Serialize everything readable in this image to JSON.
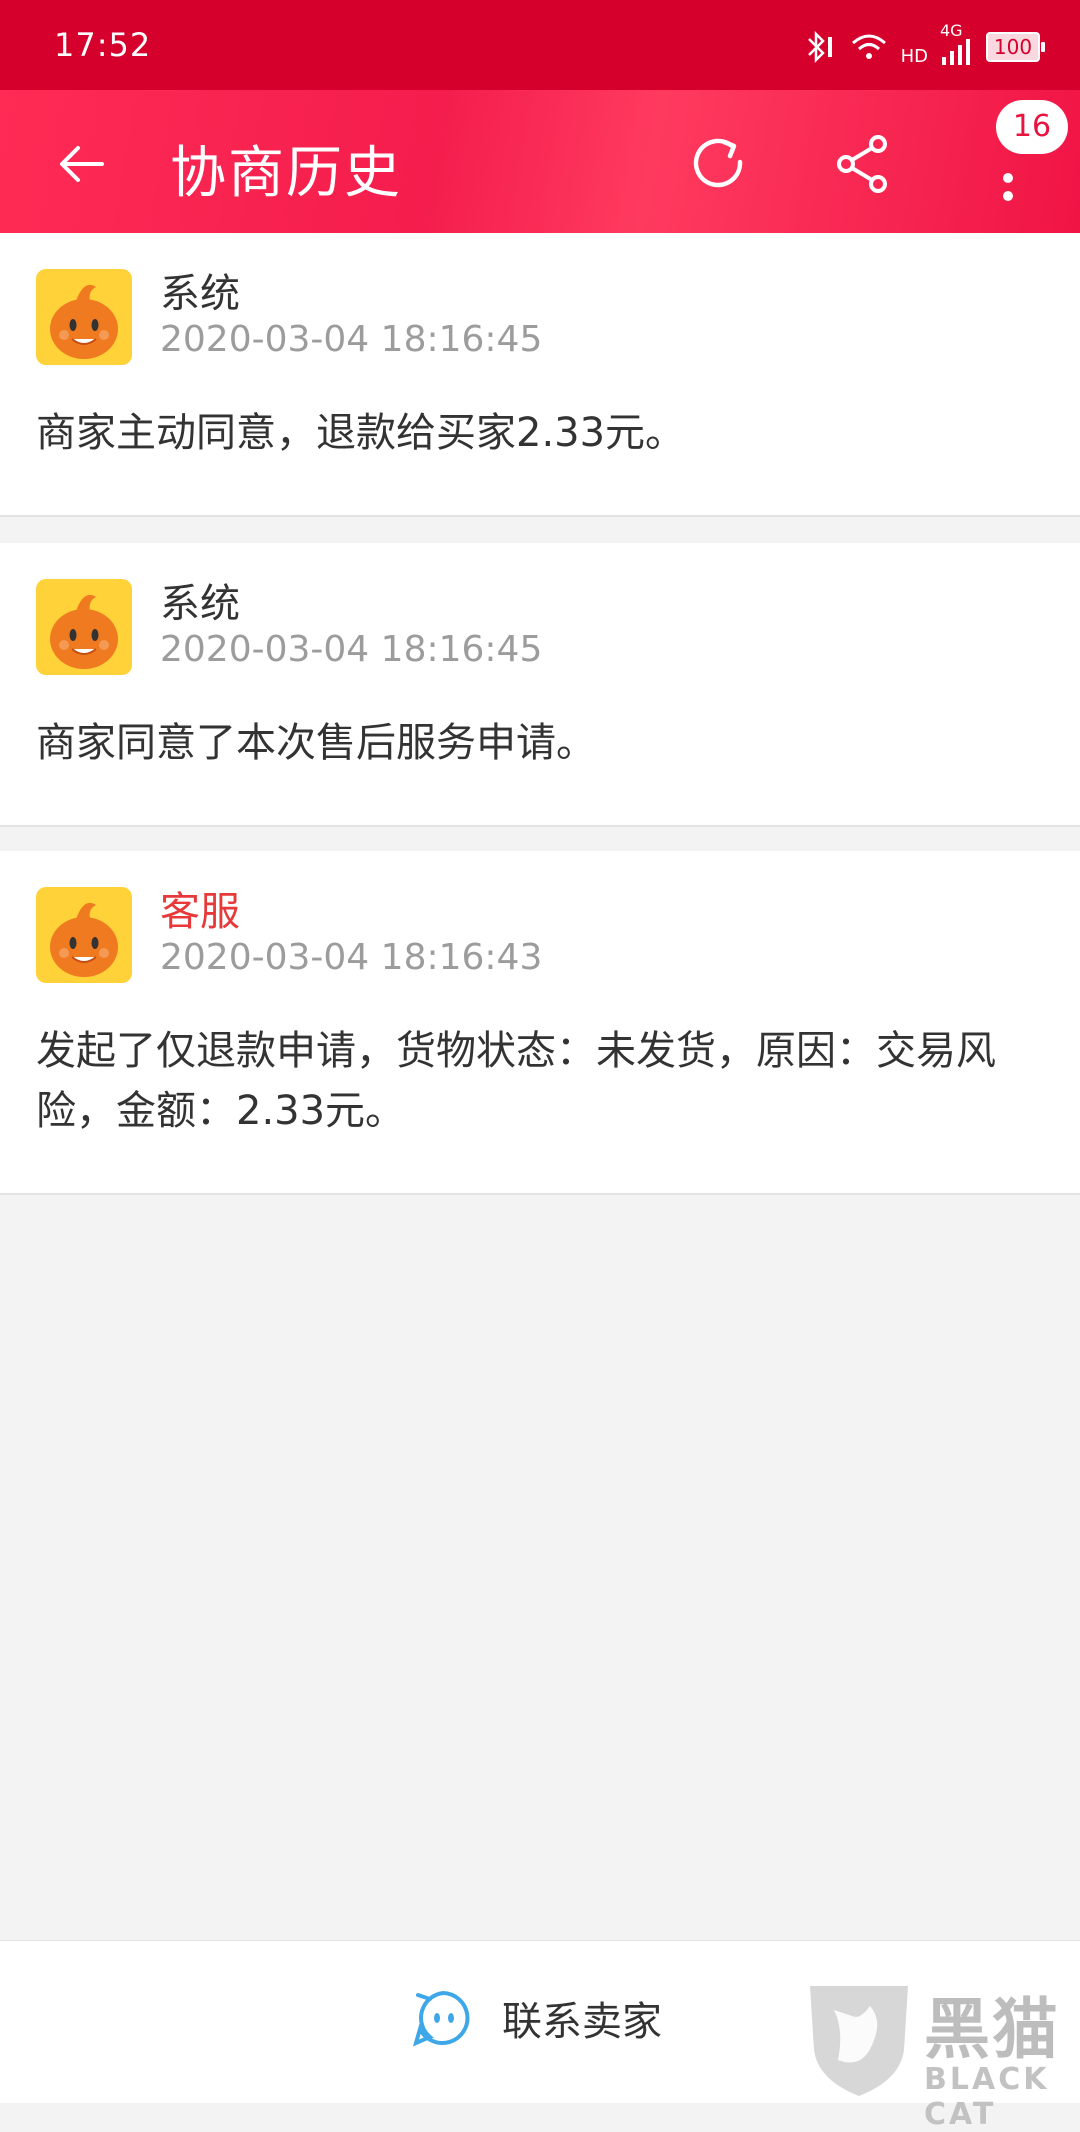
{
  "status_bar": {
    "time": "17:52",
    "network": "4G",
    "hd": "HD",
    "battery": "100"
  },
  "app_bar": {
    "title": "协商历史",
    "badge_count": "16",
    "icons": [
      "back-arrow-icon",
      "refresh-icon",
      "share-icon",
      "more-vert-icon"
    ]
  },
  "messages": [
    {
      "sender": "系统",
      "time": "2020-03-04 18:16:45",
      "text": "商家主动同意，退款给买家2.33元。"
    },
    {
      "sender": "系统",
      "time": "2020-03-04 18:16:45",
      "text": "商家同意了本次售后服务申请。"
    },
    {
      "sender": "客服",
      "time": "2020-03-04 18:16:43",
      "text": "发起了仅退款申请，货物状态：未发货，原因：交易风险，金额：2.33元。",
      "sender_color": "#e8393a"
    }
  ],
  "bottom_bar": {
    "contact_label": "联系卖家"
  },
  "watermark": {
    "cn": "黑猫",
    "en": "BLACK CAT"
  },
  "colors": {
    "status_bar": "#d6002d",
    "app_bar": "#f41d4d",
    "accent_red": "#e8393a",
    "contact_icon": "#3ea7e8"
  }
}
